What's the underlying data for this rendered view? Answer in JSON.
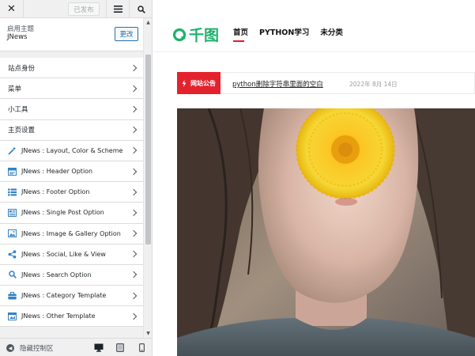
{
  "topbar": {
    "published_label": "已发布"
  },
  "theme": {
    "label": "启用主题",
    "name": "JNews",
    "change_label": "更改"
  },
  "panels": [
    {
      "label": "站点身份",
      "icon": ""
    },
    {
      "label": "菜单",
      "icon": ""
    },
    {
      "label": "小工具",
      "icon": ""
    },
    {
      "label": "主页设置",
      "icon": ""
    },
    {
      "label": "JNews : Layout, Color & Scheme",
      "icon": "magic-wand-icon"
    },
    {
      "label": "JNews : Header Option",
      "icon": "header-icon"
    },
    {
      "label": "JNews : Footer Option",
      "icon": "list-icon"
    },
    {
      "label": "JNews : Single Post Option",
      "icon": "post-icon"
    },
    {
      "label": "JNews : Image & Gallery Option",
      "icon": "image-icon"
    },
    {
      "label": "JNews : Social, Like & View",
      "icon": "share-icon"
    },
    {
      "label": "JNews : Search Option",
      "icon": "search-icon"
    },
    {
      "label": "JNews : Category Template",
      "icon": "briefcase-icon"
    },
    {
      "label": "JNews : Other Template",
      "icon": "template-icon"
    }
  ],
  "bottombar": {
    "hide_controls_label": "隐藏控制区"
  },
  "site": {
    "logo_text": "千图",
    "nav": [
      "首页",
      "PYTHON学习",
      "未分类"
    ],
    "notice_badge": "网站公告",
    "notice_link": "python删除字符串里面的空白",
    "notice_date": "2022年 8月 14日"
  },
  "colors": {
    "accent": "#2271b1",
    "brand_green": "#1db16c",
    "notice_red": "#e4222e",
    "icon_blue": "#3582c4"
  }
}
